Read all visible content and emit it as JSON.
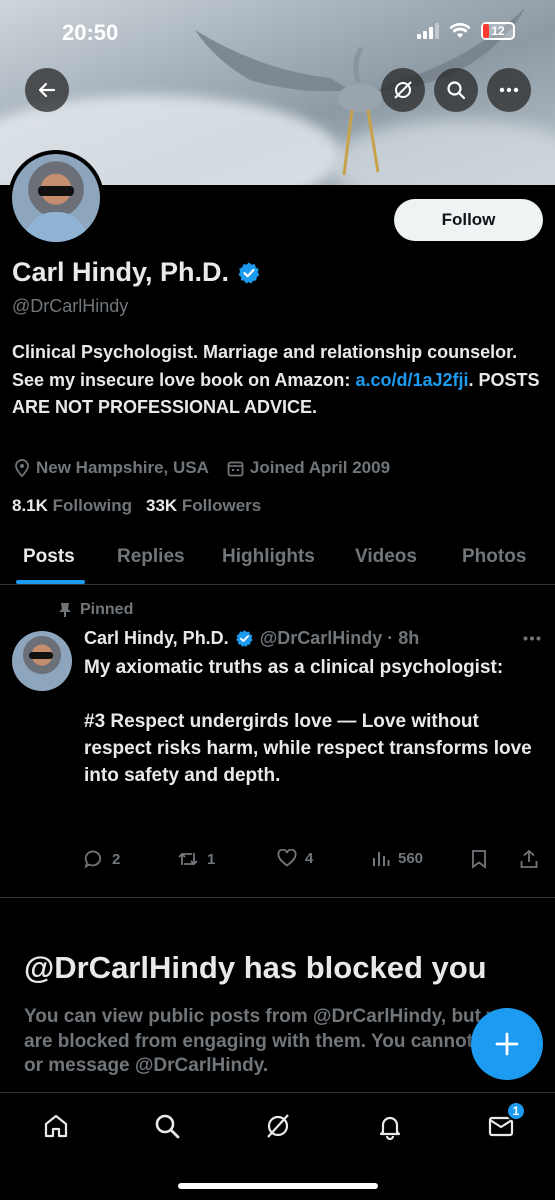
{
  "status_bar": {
    "time": "20:50",
    "battery": "12"
  },
  "profile": {
    "display_name": "Carl Hindy, Ph.D.",
    "handle": "@DrCarlHindy",
    "follow_label": "Follow",
    "bio_part1": "Clinical Psychologist. Marriage and relationship counselor. See my insecure love book on Amazon: ",
    "bio_link": "a.co/d/1aJ2fji",
    "bio_part2": ". POSTS ARE NOT PROFESSIONAL ADVICE.",
    "location": "New Hampshire, USA",
    "joined": "Joined April 2009",
    "following_count": "8.1K",
    "following_label": "Following",
    "followers_count": "33K",
    "followers_label": "Followers"
  },
  "tabs": [
    "Posts",
    "Replies",
    "Highlights",
    "Videos",
    "Photos"
  ],
  "pinned_post": {
    "pinned_label": "Pinned",
    "author": "Carl Hindy, Ph.D.",
    "handle_time": "@DrCarlHindy · 8h",
    "text": "My axiomatic truths as a clinical psychologist:\n\n#3  Respect undergirds love — Love without respect risks harm, while respect transforms love\ninto safety and depth.",
    "replies": "2",
    "reposts": "1",
    "likes": "4",
    "views": "560"
  },
  "blocked": {
    "title": "@DrCarlHindy has blocked you",
    "text": "You can view public posts from @DrCarlHindy, but you are blocked from engaging with them. You cannot follow or message @DrCarlHindy."
  },
  "nav": {
    "messages_badge": "1"
  },
  "colors": {
    "accent": "#1d9bf0",
    "background": "#000000",
    "muted": "#71767b"
  }
}
